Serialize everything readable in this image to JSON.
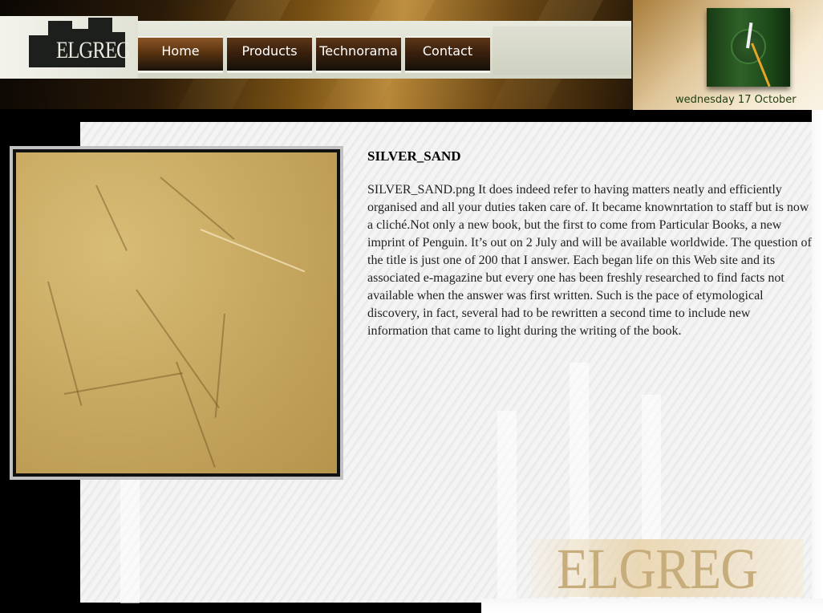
{
  "brand": {
    "logo_text": "ELGREG"
  },
  "nav": {
    "items": [
      {
        "label": "Home"
      },
      {
        "label": "Products"
      },
      {
        "label": "Technorama"
      },
      {
        "label": "Contact"
      }
    ]
  },
  "clock": {
    "date_text": "wednesday 17 October"
  },
  "article": {
    "title": "SILVER_SAND",
    "body": "SILVER_SAND.png It does indeed refer to having matters neatly and efficiently organised and all your duties taken care of. It became knownrtation to staff but is now a cliché.Not only a new book, but the first to come from Particular Books, a new imprint of Penguin. It’s out on 2 July and will be available worldwide. The question of the title is just one of 200 that I answer. Each began life on this Web site and its associated e-magazine but every one has been freshly researched to find facts not available when the answer was first written. Such is the pace of etymological discovery, in fact, several had to be rewritten a second time to include new information that came to light during the writing of the book."
  },
  "footer": {
    "logo_text": "ELGREG"
  },
  "colors": {
    "header_gold": "#b88838",
    "nav_dark": "#3a200c",
    "date_text": "#1f3d10",
    "footer_logo": "#c7ad7c"
  }
}
